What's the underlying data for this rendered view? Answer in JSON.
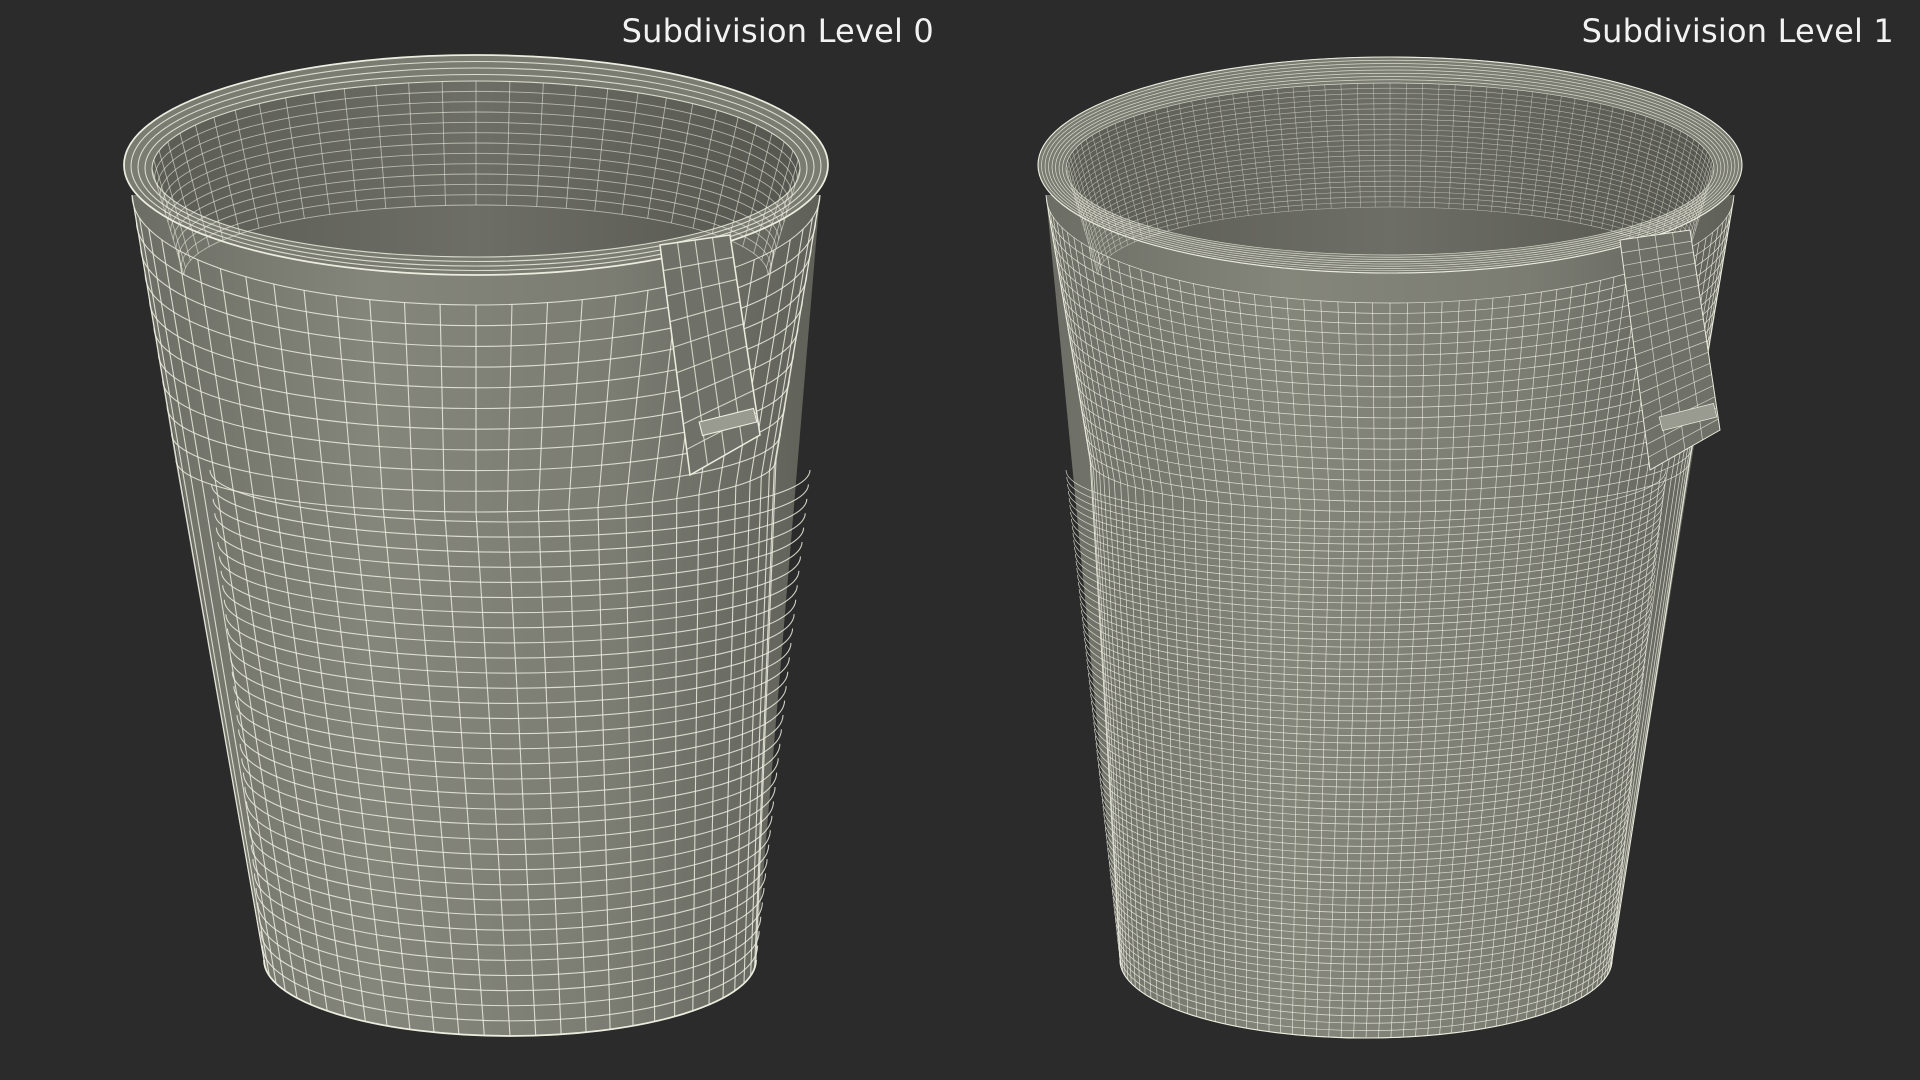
{
  "viewports": [
    {
      "label": "Subdivision Level 0",
      "subdivision": 0
    },
    {
      "label": "Subdivision Level 1",
      "subdivision": 1
    }
  ],
  "colors": {
    "background": "#2b2b2b",
    "surface": "#74756b",
    "surface_light": "#8d8e83",
    "inner_dark": "#62635a",
    "wire": "#ececdf",
    "label_text": "#f2f2f2"
  }
}
